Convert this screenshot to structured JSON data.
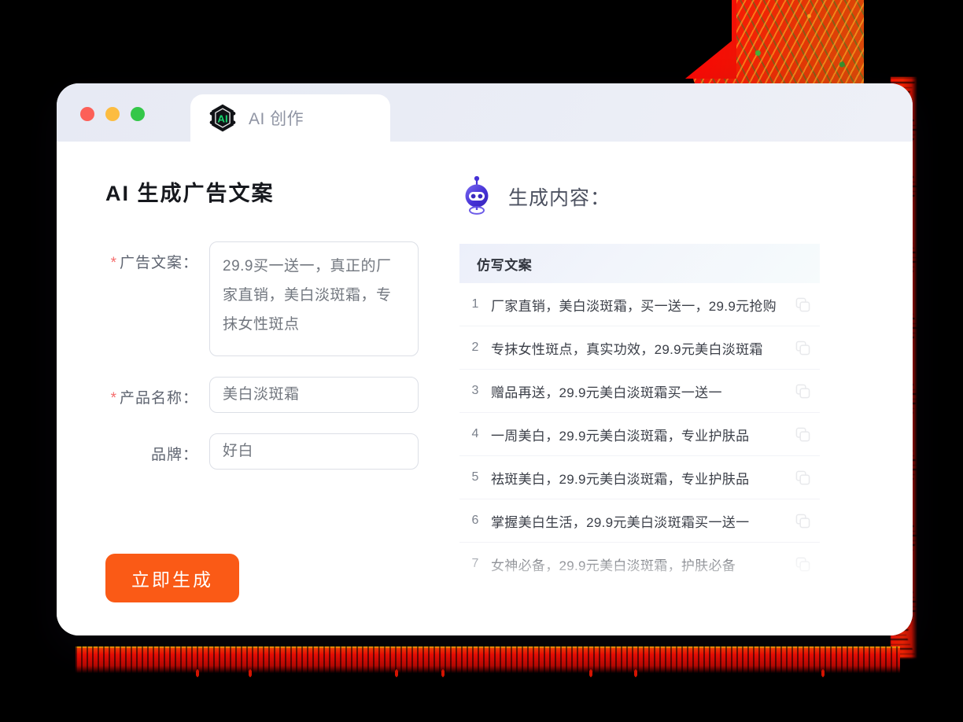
{
  "window": {
    "traffic_lights": [
      "close",
      "minimize",
      "maximize"
    ],
    "tab_label": "AI 创作",
    "tab_icon": "ai-hexagon-icon"
  },
  "left_panel": {
    "title": "AI 生成广告文案",
    "fields": [
      {
        "label": "广告文案：",
        "required": true,
        "type": "textarea",
        "value": "29.9买一送一，真正的厂家直销，美白淡斑霜，专抹女性斑点"
      },
      {
        "label": "产品名称：",
        "required": true,
        "type": "input",
        "value": "美白淡斑霜"
      },
      {
        "label": "品牌：",
        "required": false,
        "type": "input",
        "value": "好白"
      }
    ],
    "submit_button": "立即生成"
  },
  "right_panel": {
    "icon": "robot-icon",
    "title": "生成内容：",
    "table": {
      "header": "仿写文案",
      "rows": [
        {
          "index": "1",
          "text": "厂家直销，美白淡斑霜，买一送一，29.9元抢购"
        },
        {
          "index": "2",
          "text": "专抹女性斑点，真实功效，29.9元美白淡斑霜"
        },
        {
          "index": "3",
          "text": "赠品再送，29.9元美白淡斑霜买一送一"
        },
        {
          "index": "4",
          "text": "一周美白，29.9元美白淡斑霜，专业护肤品"
        },
        {
          "index": "5",
          "text": "祛斑美白，29.9元美白淡斑霜，专业护肤品"
        },
        {
          "index": "6",
          "text": "掌握美白生活，29.9元美白淡斑霜买一送一"
        },
        {
          "index": "7",
          "text": "女神必备，29.9元美白淡斑霜，护肤必备"
        }
      ],
      "row_action_icon": "copy-icon"
    }
  },
  "colors": {
    "accent_orange": "#fa5a16",
    "required_star": "#f56c6c",
    "titlebar": "#e9ecf5",
    "logo_green": "#18d66e",
    "robot_purple": "#4632d6",
    "decoration_red": "#f40c00"
  }
}
